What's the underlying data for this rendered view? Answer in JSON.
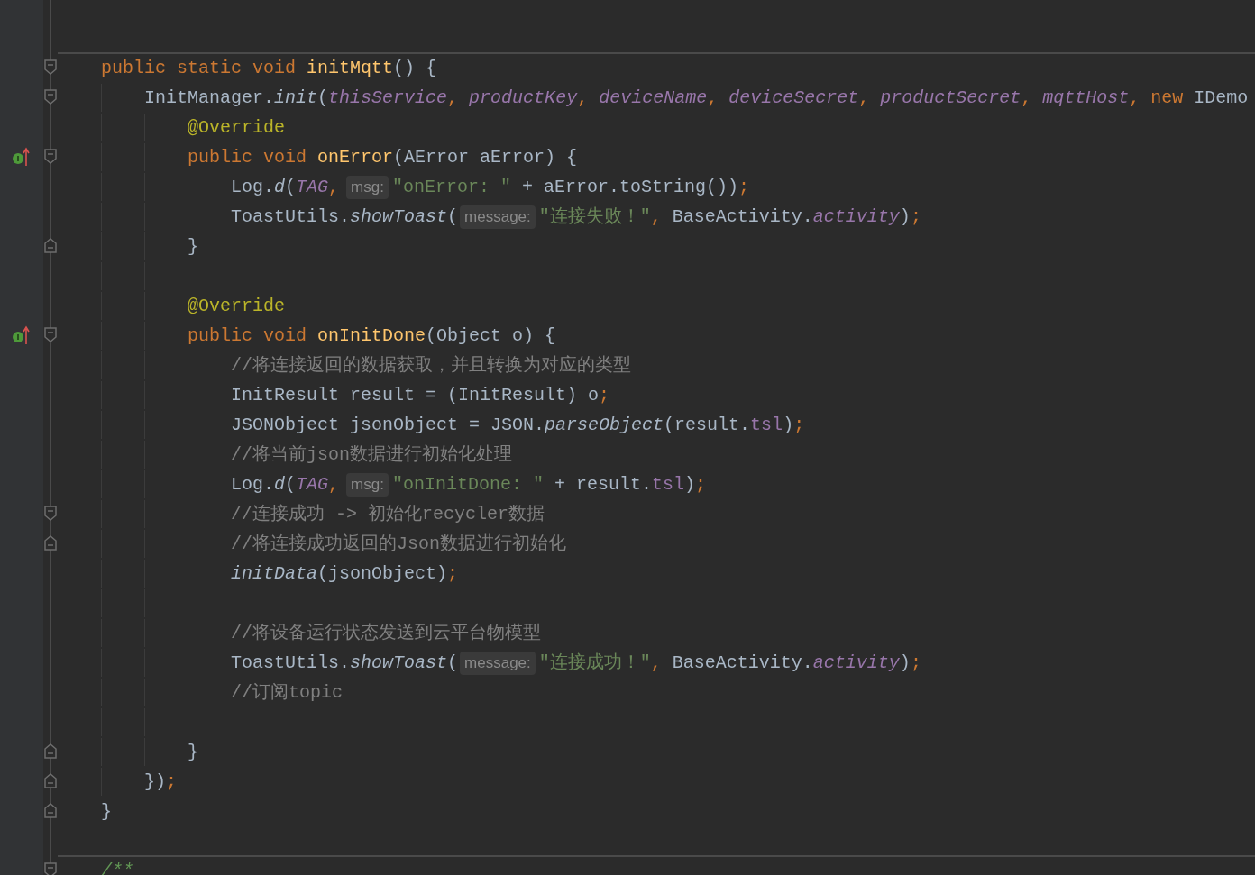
{
  "editor": {
    "lines": [
      {
        "separator": true,
        "override": false,
        "fold_start": true,
        "fold_end": false,
        "parts": [
          {
            "kind": "code",
            "tokens": [
              {
                "kind": "kw",
                "text": "public static void "
              },
              {
                "kind": "decl",
                "text": "initMqtt"
              },
              {
                "kind": "plain",
                "text": "() {"
              }
            ]
          }
        ],
        "children": [
          {
            "separator": false,
            "override": false,
            "fold_start": true,
            "fold_end": false,
            "parts": [
              {
                "kind": "code",
                "tokens": [
                  {
                    "kind": "plain",
                    "text": "InitManager."
                  },
                  {
                    "kind": "call",
                    "text": "init"
                  },
                  {
                    "kind": "plain",
                    "text": "("
                  },
                  {
                    "kind": "field",
                    "text": "thisService"
                  },
                  {
                    "kind": "punct",
                    "text": ", "
                  },
                  {
                    "kind": "field",
                    "text": "productKey"
                  },
                  {
                    "kind": "punct",
                    "text": ", "
                  },
                  {
                    "kind": "field",
                    "text": "deviceName"
                  },
                  {
                    "kind": "punct",
                    "text": ", "
                  },
                  {
                    "kind": "field",
                    "text": "deviceSecret"
                  },
                  {
                    "kind": "punct",
                    "text": ", "
                  },
                  {
                    "kind": "field",
                    "text": "productSecret"
                  },
                  {
                    "kind": "punct",
                    "text": ", "
                  },
                  {
                    "kind": "field",
                    "text": "mqttHost"
                  },
                  {
                    "kind": "punct",
                    "text": ", "
                  },
                  {
                    "kind": "kw",
                    "text": "new "
                  },
                  {
                    "kind": "plain",
                    "text": "IDemo"
                  }
                ]
              }
            ],
            "children": [
              {
                "separator": false,
                "override": false,
                "fold_start": false,
                "fold_end": false,
                "parts": [
                  {
                    "kind": "code",
                    "tokens": [
                      {
                        "kind": "ann",
                        "text": "@Override"
                      }
                    ]
                  }
                ]
              },
              {
                "separator": false,
                "override": true,
                "fold_start": true,
                "fold_end": false,
                "parts": [
                  {
                    "kind": "code",
                    "tokens": [
                      {
                        "kind": "kw",
                        "text": "public void "
                      },
                      {
                        "kind": "decl",
                        "text": "onError"
                      },
                      {
                        "kind": "plain",
                        "text": "(AError aError) {"
                      }
                    ]
                  }
                ],
                "children": [
                  {
                    "separator": false,
                    "override": false,
                    "fold_start": false,
                    "fold_end": false,
                    "parts": [
                      {
                        "kind": "code",
                        "tokens": [
                          {
                            "kind": "plain",
                            "text": "Log."
                          },
                          {
                            "kind": "call",
                            "text": "d"
                          },
                          {
                            "kind": "plain",
                            "text": "("
                          },
                          {
                            "kind": "field",
                            "text": "TAG"
                          },
                          {
                            "kind": "punct",
                            "text": ","
                          }
                        ]
                      },
                      {
                        "kind": "hint",
                        "text": "msg:"
                      },
                      {
                        "kind": "code",
                        "tokens": [
                          {
                            "kind": "str",
                            "text": "\"onError: \""
                          },
                          {
                            "kind": "plain",
                            "text": " + aError.toString())"
                          },
                          {
                            "kind": "punct",
                            "text": ";"
                          }
                        ]
                      }
                    ]
                  },
                  {
                    "separator": false,
                    "override": false,
                    "fold_start": false,
                    "fold_end": false,
                    "parts": [
                      {
                        "kind": "code",
                        "tokens": [
                          {
                            "kind": "plain",
                            "text": "ToastUtils."
                          },
                          {
                            "kind": "call",
                            "text": "showToast"
                          },
                          {
                            "kind": "plain",
                            "text": "("
                          }
                        ]
                      },
                      {
                        "kind": "hint",
                        "text": "message:"
                      },
                      {
                        "kind": "code",
                        "tokens": [
                          {
                            "kind": "str",
                            "text": "\"连接失败！\""
                          },
                          {
                            "kind": "punct",
                            "text": ", "
                          },
                          {
                            "kind": "plain",
                            "text": "BaseActivity."
                          },
                          {
                            "kind": "field",
                            "text": "activity"
                          },
                          {
                            "kind": "plain",
                            "text": ")"
                          },
                          {
                            "kind": "punct",
                            "text": ";"
                          }
                        ]
                      }
                    ]
                  }
                ]
              },
              {
                "separator": false,
                "override": false,
                "fold_start": false,
                "fold_end": true,
                "parts": [
                  {
                    "kind": "code",
                    "tokens": [
                      {
                        "kind": "plain",
                        "text": "}"
                      }
                    ]
                  }
                ]
              },
              {
                "separator": false,
                "override": false,
                "fold_start": false,
                "fold_end": false
              },
              {
                "separator": false,
                "override": false,
                "fold_start": false,
                "fold_end": false,
                "parts": [
                  {
                    "kind": "code",
                    "tokens": [
                      {
                        "kind": "ann",
                        "text": "@Override"
                      }
                    ]
                  }
                ]
              },
              {
                "separator": false,
                "override": true,
                "fold_start": true,
                "fold_end": false,
                "parts": [
                  {
                    "kind": "code",
                    "tokens": [
                      {
                        "kind": "kw",
                        "text": "public void "
                      },
                      {
                        "kind": "decl",
                        "text": "onInitDone"
                      },
                      {
                        "kind": "plain",
                        "text": "(Object o) {"
                      }
                    ]
                  }
                ],
                "children": [
                  {
                    "separator": false,
                    "override": false,
                    "fold_start": false,
                    "fold_end": false,
                    "parts": [
                      {
                        "kind": "code",
                        "tokens": [
                          {
                            "kind": "cmt",
                            "text": "//将连接返回的数据获取，并且转换为对应的类型"
                          }
                        ]
                      }
                    ]
                  },
                  {
                    "separator": false,
                    "override": false,
                    "fold_start": false,
                    "fold_end": false,
                    "parts": [
                      {
                        "kind": "code",
                        "tokens": [
                          {
                            "kind": "plain",
                            "text": "InitResult result = (InitResult) o"
                          },
                          {
                            "kind": "punct",
                            "text": ";"
                          }
                        ]
                      }
                    ]
                  },
                  {
                    "separator": false,
                    "override": false,
                    "fold_start": false,
                    "fold_end": false,
                    "parts": [
                      {
                        "kind": "code",
                        "tokens": [
                          {
                            "kind": "plain",
                            "text": "JSONObject jsonObject = JSON."
                          },
                          {
                            "kind": "call",
                            "text": "parseObject"
                          },
                          {
                            "kind": "plain",
                            "text": "(result."
                          },
                          {
                            "kind": "member",
                            "text": "tsl"
                          },
                          {
                            "kind": "plain",
                            "text": ")"
                          },
                          {
                            "kind": "punct",
                            "text": ";"
                          }
                        ]
                      }
                    ]
                  },
                  {
                    "separator": false,
                    "override": false,
                    "fold_start": false,
                    "fold_end": false,
                    "parts": [
                      {
                        "kind": "code",
                        "tokens": [
                          {
                            "kind": "cmt",
                            "text": "//将当前json数据进行初始化处理"
                          }
                        ]
                      }
                    ]
                  },
                  {
                    "separator": false,
                    "override": false,
                    "fold_start": false,
                    "fold_end": false,
                    "parts": [
                      {
                        "kind": "code",
                        "tokens": [
                          {
                            "kind": "plain",
                            "text": "Log."
                          },
                          {
                            "kind": "call",
                            "text": "d"
                          },
                          {
                            "kind": "plain",
                            "text": "("
                          },
                          {
                            "kind": "field",
                            "text": "TAG"
                          },
                          {
                            "kind": "punct",
                            "text": ","
                          }
                        ]
                      },
                      {
                        "kind": "hint",
                        "text": "msg:"
                      },
                      {
                        "kind": "code",
                        "tokens": [
                          {
                            "kind": "str",
                            "text": "\"onInitDone: \""
                          },
                          {
                            "kind": "plain",
                            "text": " + result."
                          },
                          {
                            "kind": "member",
                            "text": "tsl"
                          },
                          {
                            "kind": "plain",
                            "text": ")"
                          },
                          {
                            "kind": "punct",
                            "text": ";"
                          }
                        ]
                      }
                    ]
                  },
                  {
                    "separator": false,
                    "override": false,
                    "fold_start": true,
                    "fold_end": false,
                    "parts": [
                      {
                        "kind": "code",
                        "tokens": [
                          {
                            "kind": "cmt",
                            "text": "//连接成功 -> 初始化recycler数据"
                          }
                        ]
                      }
                    ]
                  },
                  {
                    "separator": false,
                    "override": false,
                    "fold_start": false,
                    "fold_end": true,
                    "parts": [
                      {
                        "kind": "code",
                        "tokens": [
                          {
                            "kind": "cmt",
                            "text": "//将连接成功返回的Json数据进行初始化"
                          }
                        ]
                      }
                    ]
                  },
                  {
                    "separator": false,
                    "override": false,
                    "fold_start": false,
                    "fold_end": false,
                    "parts": [
                      {
                        "kind": "code",
                        "tokens": [
                          {
                            "kind": "call",
                            "text": "initData"
                          },
                          {
                            "kind": "plain",
                            "text": "(jsonObject)"
                          },
                          {
                            "kind": "punct",
                            "text": ";"
                          }
                        ]
                      }
                    ]
                  },
                  {
                    "separator": false,
                    "override": false,
                    "fold_start": false,
                    "fold_end": false
                  },
                  {
                    "separator": false,
                    "override": false,
                    "fold_start": false,
                    "fold_end": false,
                    "parts": [
                      {
                        "kind": "code",
                        "tokens": [
                          {
                            "kind": "cmt",
                            "text": "//将设备运行状态发送到云平台物模型"
                          }
                        ]
                      }
                    ]
                  },
                  {
                    "separator": false,
                    "override": false,
                    "fold_start": false,
                    "fold_end": false,
                    "parts": [
                      {
                        "kind": "code",
                        "tokens": [
                          {
                            "kind": "plain",
                            "text": "ToastUtils."
                          },
                          {
                            "kind": "call",
                            "text": "showToast"
                          },
                          {
                            "kind": "plain",
                            "text": "("
                          }
                        ]
                      },
                      {
                        "kind": "hint",
                        "text": "message:"
                      },
                      {
                        "kind": "code",
                        "tokens": [
                          {
                            "kind": "str",
                            "text": "\"连接成功！\""
                          },
                          {
                            "kind": "punct",
                            "text": ", "
                          },
                          {
                            "kind": "plain",
                            "text": "BaseActivity."
                          },
                          {
                            "kind": "field",
                            "text": "activity"
                          },
                          {
                            "kind": "plain",
                            "text": ")"
                          },
                          {
                            "kind": "punct",
                            "text": ";"
                          }
                        ]
                      }
                    ]
                  },
                  {
                    "separator": false,
                    "override": false,
                    "fold_start": false,
                    "fold_end": false,
                    "parts": [
                      {
                        "kind": "code",
                        "tokens": [
                          {
                            "kind": "cmt",
                            "text": "//订阅topic"
                          }
                        ]
                      }
                    ]
                  },
                  {
                    "separator": false,
                    "override": false,
                    "fold_start": false,
                    "fold_end": false
                  }
                ]
              },
              {
                "separator": false,
                "override": false,
                "fold_start": false,
                "fold_end": true,
                "parts": [
                  {
                    "kind": "code",
                    "tokens": [
                      {
                        "kind": "plain",
                        "text": "}"
                      }
                    ]
                  }
                ]
              }
            ]
          },
          {
            "separator": false,
            "override": false,
            "fold_start": false,
            "fold_end": true,
            "parts": [
              {
                "kind": "code",
                "tokens": [
                  {
                    "kind": "plain",
                    "text": "})"
                  },
                  {
                    "kind": "punct",
                    "text": ";"
                  }
                ]
              }
            ]
          }
        ]
      },
      {
        "separator": false,
        "override": false,
        "fold_start": false,
        "fold_end": true,
        "parts": [
          {
            "kind": "code",
            "tokens": [
              {
                "kind": "plain",
                "text": "}"
              }
            ]
          }
        ]
      },
      {
        "separator": false,
        "override": false,
        "fold_start": false,
        "fold_end": false
      },
      {
        "separator": true,
        "override": false,
        "fold_start": true,
        "fold_end": false,
        "parts": [
          {
            "kind": "code",
            "tokens": [
              {
                "kind": "doc",
                "text": "/**"
              }
            ]
          }
        ]
      }
    ]
  }
}
